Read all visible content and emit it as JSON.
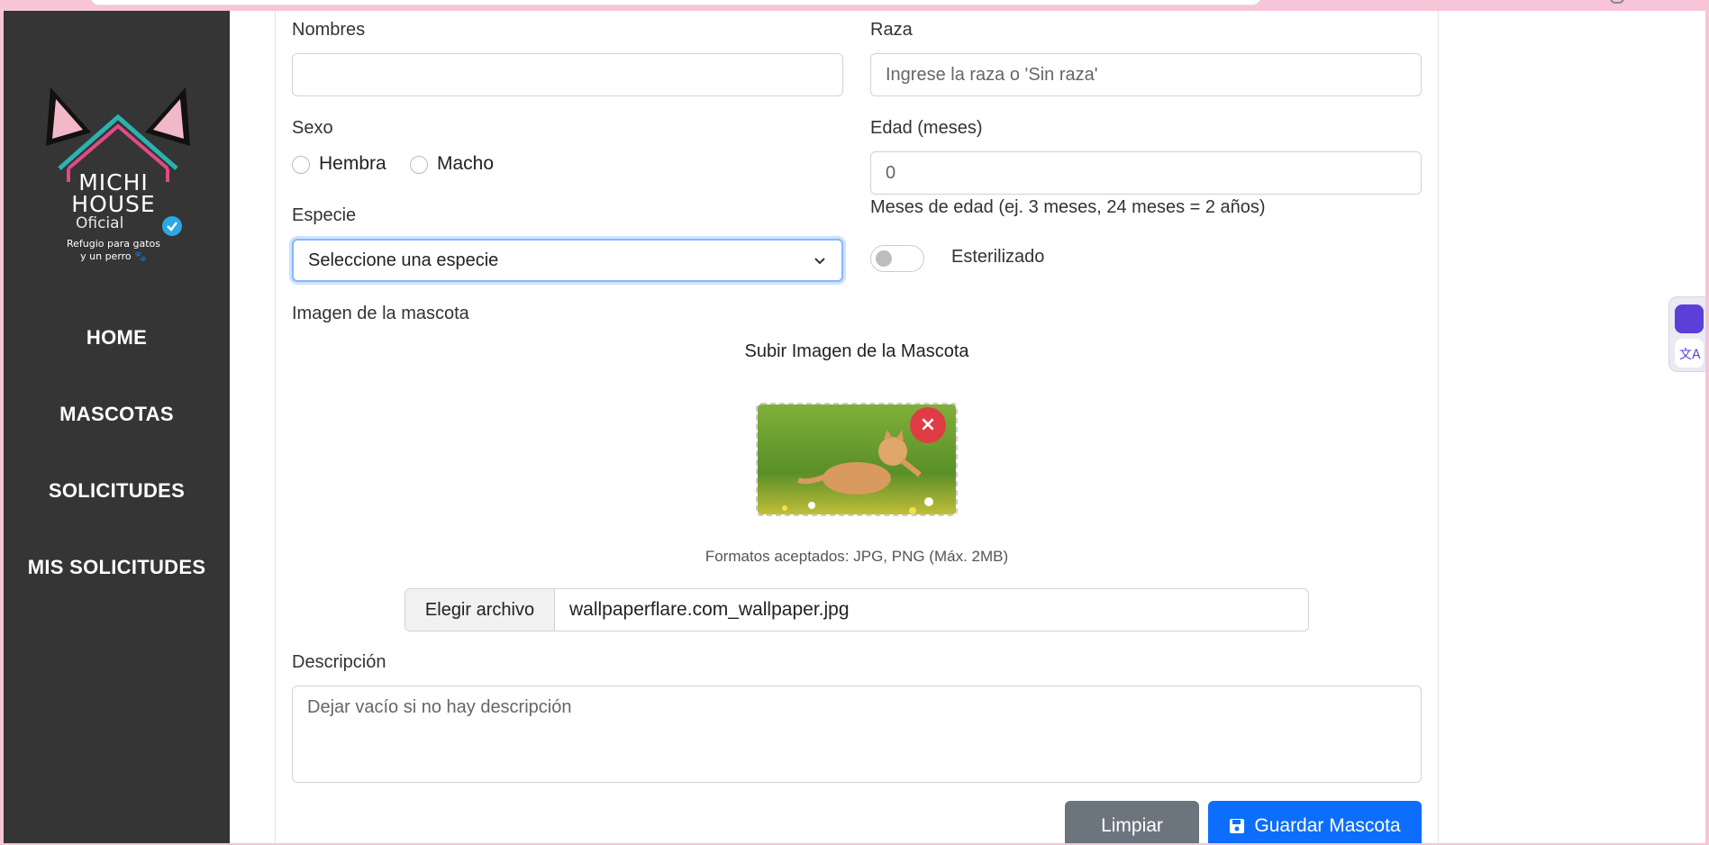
{
  "sidebar": {
    "logo": {
      "line1": "MICHI",
      "line2": "HOUSE",
      "line3": "Oficial",
      "tagline1": "Refugio para gatos",
      "tagline2": "y un perro 🐾"
    },
    "nav": [
      "HOME",
      "MASCOTAS",
      "SOLICITUDES",
      "MIS SOLICITUDES"
    ]
  },
  "form": {
    "nombres_label": "Nombres",
    "nombres_value": "",
    "raza_label": "Raza",
    "raza_placeholder": "Ingrese la raza o 'Sin raza'",
    "sexo_label": "Sexo",
    "sexo_options": [
      "Hembra",
      "Macho"
    ],
    "edad_label": "Edad (meses)",
    "edad_value": "0",
    "edad_help": "Meses de edad (ej. 3 meses, 24 meses = 2 años)",
    "especie_label": "Especie",
    "especie_selected": "Seleccione una especie",
    "esterilizado_label": "Esterilizado",
    "esterilizado_on": false,
    "imagen_label": "Imagen de la mascota",
    "upload_title": "Subir Imagen de la Mascota",
    "remove_icon": "×",
    "formats_text": "Formatos aceptados: JPG, PNG (Máx. 2MB)",
    "file_button": "Elegir archivo",
    "file_name": "wallpaperflare.com_wallpaper.jpg",
    "descripcion_label": "Descripción",
    "descripcion_placeholder": "Dejar vacío si no hay descripción",
    "limpiar_label": "Limpiar",
    "guardar_label": "Guardar Mascota"
  },
  "colors": {
    "sidebar_bg": "#353535",
    "primary": "#0d6efd",
    "secondary": "#6c757d",
    "danger": "#e03c46",
    "accent_teal": "#2bb3b1"
  },
  "icons": {
    "save": "save-icon",
    "remove": "close-icon",
    "chevron": "chevron-down-icon"
  }
}
